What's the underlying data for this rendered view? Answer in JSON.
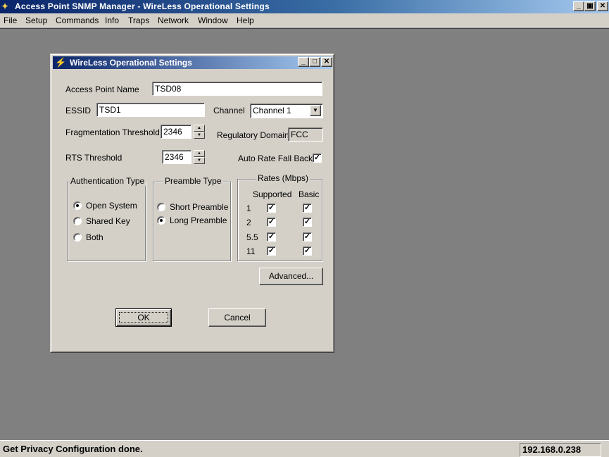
{
  "app": {
    "title": "Access Point SNMP Manager - WireLess Operational Settings",
    "icon": "satellite-icon",
    "window_buttons": {
      "minimize": "_",
      "maximize": "▣",
      "close": "✕"
    }
  },
  "menu": [
    "File",
    "Setup",
    "Commands",
    "Info",
    "Traps",
    "Network",
    "Window",
    "Help"
  ],
  "dialog": {
    "title": "WireLess Operational Settings",
    "icon": "lightning-icon",
    "window_buttons": {
      "minimize": "_",
      "maximize": "□",
      "close": "✕"
    },
    "access_point_name": {
      "label": "Access Point Name",
      "value": "TSD08"
    },
    "essid": {
      "label": "ESSID",
      "value": "TSD1"
    },
    "channel": {
      "label": "Channel",
      "value": "Channel 1"
    },
    "fragmentation_threshold": {
      "label": "Fragmentation Threshold",
      "value": "2346"
    },
    "regulatory_domain": {
      "label": "Regulatory Domain",
      "value": "FCC"
    },
    "rts_threshold": {
      "label": "RTS Threshold",
      "value": "2346"
    },
    "auto_rate_fall_back": {
      "label": "Auto Rate Fall Back",
      "checked": true
    },
    "authentication_type": {
      "label": "Authentication Type",
      "options": [
        {
          "label": "Open System",
          "selected": true
        },
        {
          "label": "Shared Key",
          "selected": false
        },
        {
          "label": "Both",
          "selected": false
        }
      ]
    },
    "preamble_type": {
      "label": "Preamble Type",
      "options": [
        {
          "label": "Short Preamble",
          "selected": false
        },
        {
          "label": "Long Preamble",
          "selected": true
        }
      ]
    },
    "rates": {
      "label": "Rates (Mbps)",
      "col_supported": "Supported",
      "col_basic": "Basic",
      "rows": [
        {
          "rate": "1",
          "supported": true,
          "basic": true
        },
        {
          "rate": "2",
          "supported": true,
          "basic": true
        },
        {
          "rate": "5.5",
          "supported": true,
          "basic": true
        },
        {
          "rate": "11",
          "supported": true,
          "basic": true
        }
      ]
    },
    "advanced_button": "Advanced...",
    "ok_button": "OK",
    "cancel_button": "Cancel"
  },
  "status": {
    "message": "Get Privacy Configuration done.",
    "ip": "192.168.0.238"
  }
}
